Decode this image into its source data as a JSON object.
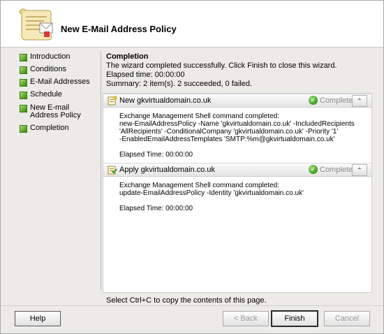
{
  "header": {
    "title": "New E-Mail Address Policy"
  },
  "sidebar": {
    "steps": [
      {
        "label": "Introduction"
      },
      {
        "label": "Conditions"
      },
      {
        "label": "E-Mail Addresses"
      },
      {
        "label": "Schedule"
      },
      {
        "label": "New E-mail Address Policy"
      },
      {
        "label": "Completion"
      }
    ]
  },
  "main": {
    "heading": "Completion",
    "message": "The wizard completed successfully. Click Finish to close this wizard.",
    "elapsed": "Elapsed time: 00:00:00",
    "summary": "Summary: 2 item(s). 2 succeeded, 0 failed.",
    "tasks": [
      {
        "title": "New gkvirtualdomain.co.uk",
        "status": "Completed",
        "lines": [
          "Exchange Management Shell command completed:",
          "new-EmailAddressPolicy -Name 'gkvirtualdomain.co.uk' -IncludedRecipients",
          "'AllRecipients' -ConditionalCompany 'gkvirtualdomain.co.uk' -Priority '1'",
          "-EnabledEmailAddressTemplates 'SMTP:%m@gkvirtualdomain.co.uk'"
        ],
        "elapsed": "Elapsed Time: 00:00:00"
      },
      {
        "title": "Apply gkvirtualdomain.co.uk",
        "status": "Completed",
        "lines": [
          "Exchange Management Shell command completed:",
          "update-EmailAddressPolicy -Identity 'gkvirtualdomain.co.uk'"
        ],
        "elapsed": "Elapsed Time: 00:00:00"
      }
    ],
    "copy_hint": "Select Ctrl+C to copy the contents of this page."
  },
  "buttons": {
    "help": "Help",
    "back": "< Back",
    "finish": "Finish",
    "cancel": "Cancel"
  },
  "colors": {
    "step_icon": "#5fa82a",
    "status_completed": "#3d9a1c",
    "status_text": "#8a8a8a"
  }
}
